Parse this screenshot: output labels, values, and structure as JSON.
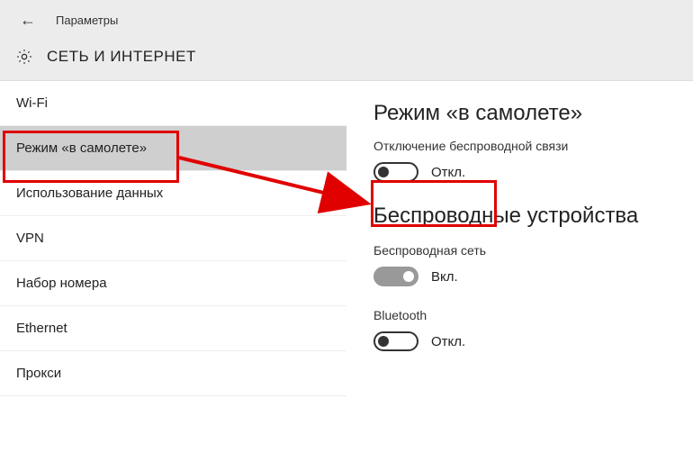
{
  "header": {
    "app_title": "Параметры",
    "page_title": "СЕТЬ И ИНТЕРНЕТ"
  },
  "sidebar": {
    "items": [
      {
        "label": "Wi-Fi",
        "selected": false
      },
      {
        "label": "Режим «в самолете»",
        "selected": true
      },
      {
        "label": "Использование данных",
        "selected": false
      },
      {
        "label": "VPN",
        "selected": false
      },
      {
        "label": "Набор номера",
        "selected": false
      },
      {
        "label": "Ethernet",
        "selected": false
      },
      {
        "label": "Прокси",
        "selected": false
      }
    ]
  },
  "content": {
    "airplane": {
      "title": "Режим «в самолете»",
      "subtitle": "Отключение беспроводной связи",
      "toggle_state": "off",
      "toggle_label": "Откл."
    },
    "wireless": {
      "title": "Беспроводные устройства",
      "wifi_label": "Беспроводная сеть",
      "wifi_state": "on",
      "wifi_toggle_label": "Вкл.",
      "bt_label": "Bluetooth",
      "bt_state": "off",
      "bt_toggle_label": "Откл."
    }
  }
}
